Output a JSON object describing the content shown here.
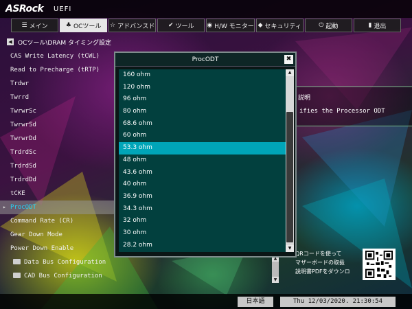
{
  "brand": {
    "logo": "ASRock",
    "product": "UEFI"
  },
  "tabs": [
    {
      "icon": "☰",
      "label": "メイン",
      "active": false,
      "name": "tab-main"
    },
    {
      "icon": "♣",
      "label": "OCツール",
      "active": true,
      "name": "tab-oc-tweaker"
    },
    {
      "icon": "☆",
      "label": "アドバンスド",
      "active": false,
      "name": "tab-advanced"
    },
    {
      "icon": "✔",
      "label": "ツール",
      "active": false,
      "name": "tab-tool"
    },
    {
      "icon": "◉",
      "label": "H/W モニター",
      "active": false,
      "name": "tab-hw-monitor"
    },
    {
      "icon": "◆",
      "label": "セキュリティ",
      "active": false,
      "name": "tab-security"
    },
    {
      "icon": "⏻",
      "label": "起動",
      "active": false,
      "name": "tab-boot"
    },
    {
      "icon": "▮",
      "label": "退出",
      "active": false,
      "name": "tab-exit"
    }
  ],
  "breadcrumb": {
    "back_icon": "◀",
    "path": "OCツール\\DRAM タイミング設定"
  },
  "menu_items": [
    {
      "label": "CAS Write Latency (tCWL)"
    },
    {
      "label": "Read to Precharge (tRTP)"
    },
    {
      "label": "Trdwr"
    },
    {
      "label": "Twrrd"
    },
    {
      "label": "TwrwrSc"
    },
    {
      "label": "TwrwrSd"
    },
    {
      "label": "TwrwrDd"
    },
    {
      "label": "TrdrdSc"
    },
    {
      "label": "TrdrdSd"
    },
    {
      "label": "TrdrdDd"
    },
    {
      "label": "tCKE"
    },
    {
      "label": "ProcODT",
      "selected": true
    },
    {
      "label": "Command Rate (CR)"
    },
    {
      "label": "Gear Down Mode"
    },
    {
      "label": "Power Down Enable"
    },
    {
      "label": "Data Bus Configuration",
      "folder": true
    },
    {
      "label": "CAD Bus Configuration",
      "folder": true
    }
  ],
  "description": {
    "title": "説明",
    "text": "ifies the Processor ODT"
  },
  "qr_text": {
    "line1": "QRコードを使って",
    "line2": "マザーボードの取扱",
    "line3": "説明書PDFをダウンロ"
  },
  "popup": {
    "title": "ProcODT",
    "close_label": "✖",
    "options": [
      "160 ohm",
      "120 ohm",
      "96 ohm",
      "80 ohm",
      "68.6 ohm",
      "60 ohm",
      "53.3 ohm",
      "48 ohm",
      "43.6 ohm",
      "40 ohm",
      "36.9 ohm",
      "34.3 ohm",
      "32 ohm",
      "30 ohm",
      "28.2 ohm"
    ],
    "selected_index": 6,
    "scroll_up": "▲",
    "scroll_down": "▼"
  },
  "footer": {
    "language": "日本語",
    "datetime": "Thu 12/03/2020. 21:30:54"
  },
  "colors": {
    "accent": "#00a5b8",
    "selected_text": "#26d4f4",
    "list_bg": "#02403e"
  }
}
